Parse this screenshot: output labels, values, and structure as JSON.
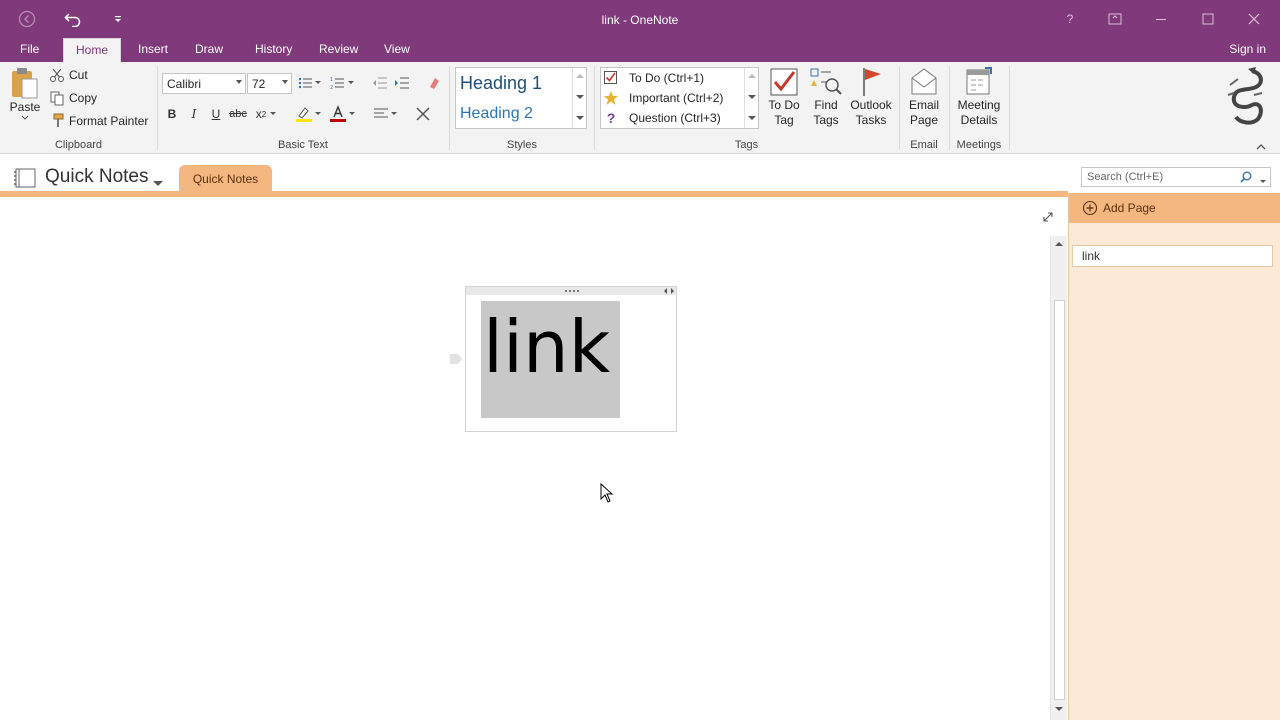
{
  "window": {
    "title": "link - OneNote",
    "help_glyph": "?",
    "colors": {
      "accent": "#80397b",
      "section": "#f4b77f",
      "pages_bg": "#fce9d8"
    }
  },
  "tabs": [
    "File",
    "Home",
    "Insert",
    "Draw",
    "History",
    "Review",
    "View"
  ],
  "signin": "Sign in",
  "ribbon": {
    "clipboard": {
      "label": "Clipboard",
      "paste": "Paste",
      "cut": "Cut",
      "copy": "Copy",
      "format_painter": "Format Painter"
    },
    "basic_text": {
      "label": "Basic Text",
      "font": "Calibri",
      "size": "72"
    },
    "styles": {
      "label": "Styles",
      "heading1": "Heading 1",
      "heading2": "Heading 2"
    },
    "tags": {
      "label": "Tags",
      "items": [
        "To Do (Ctrl+1)",
        "Important (Ctrl+2)",
        "Question (Ctrl+3)"
      ],
      "todo_tag": [
        "To Do",
        "Tag"
      ],
      "find_tags": [
        "Find",
        "Tags"
      ],
      "outlook_tasks": [
        "Outlook",
        "Tasks"
      ]
    },
    "email": {
      "label": "Email",
      "button": [
        "Email",
        "Page"
      ]
    },
    "meetings": {
      "label": "Meetings",
      "button": [
        "Meeting",
        "Details"
      ]
    }
  },
  "notebook": {
    "name": "Quick Notes",
    "section": "Quick Notes",
    "search_placeholder": "Search (Ctrl+E)"
  },
  "note": {
    "text": "link"
  },
  "pages": {
    "add_page": "Add Page",
    "items": [
      "link"
    ]
  }
}
